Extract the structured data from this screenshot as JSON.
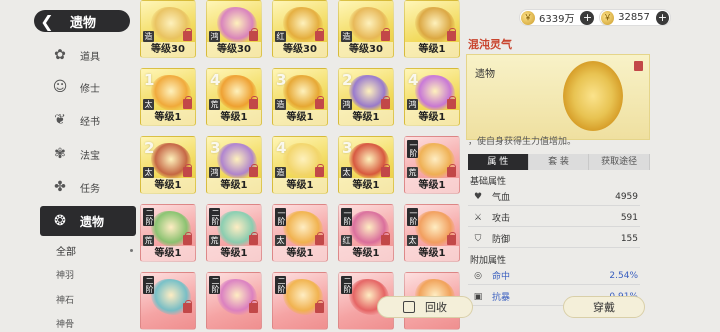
{
  "header": {
    "title": "遗物",
    "back_icon": "chevron-left-icon"
  },
  "resources": [
    {
      "icon": "coin-icon",
      "value": "6339万"
    },
    {
      "icon": "coin-icon",
      "value": "32857"
    }
  ],
  "sidebar": {
    "items": [
      {
        "label": "道具",
        "icon": "daoju-icon"
      },
      {
        "label": "修士",
        "icon": "xiushi-icon"
      },
      {
        "label": "经书",
        "icon": "jingshu-icon"
      },
      {
        "label": "法宝",
        "icon": "fabao-icon"
      },
      {
        "label": "任务",
        "icon": "renwu-icon"
      },
      {
        "label": "遗物",
        "icon": "yiwu-icon",
        "active": true
      }
    ],
    "sub_items": [
      "全部",
      "神羽",
      "神石",
      "神骨"
    ]
  },
  "grid": {
    "cards": [
      {
        "tier": "",
        "tag": "造",
        "level": "等级30",
        "style": "gold",
        "art": "#e8c060"
      },
      {
        "tier": "",
        "tag": "鸿",
        "level": "等级30",
        "style": "gold",
        "art": "#d67ac4"
      },
      {
        "tier": "",
        "tag": "红",
        "level": "等级30",
        "style": "gold",
        "art": "#e3a93a"
      },
      {
        "tier": "",
        "tag": "造",
        "level": "等级30",
        "style": "gold",
        "art": "#e6b455"
      },
      {
        "tier": "",
        "tag": "",
        "level": "等级1",
        "style": "gold",
        "art": "#d9a23f"
      },
      {
        "tier": "1",
        "tag": "太",
        "level": "等级1",
        "style": "gold",
        "art": "#f0a436"
      },
      {
        "tier": "4",
        "tag": "荒",
        "level": "等级1",
        "style": "gold",
        "art": "#ee9a2b"
      },
      {
        "tier": "3",
        "tag": "造",
        "level": "等级1",
        "style": "gold",
        "art": "#e5a22e"
      },
      {
        "tier": "2",
        "tag": "鸿",
        "level": "等级1",
        "style": "gold",
        "art": "#8f6fd6"
      },
      {
        "tier": "4",
        "tag": "鸿",
        "level": "等级1",
        "style": "gold",
        "art": "#c36de0"
      },
      {
        "tier": "2",
        "tag": "太",
        "level": "等级1",
        "style": "gold",
        "art": "#c05a40"
      },
      {
        "tier": "3",
        "tag": "鸿",
        "level": "等级1",
        "style": "gold",
        "art": "#a87ad8"
      },
      {
        "tier": "4",
        "tag": "造",
        "level": "等级1",
        "style": "gold",
        "art": "#f2d46b"
      },
      {
        "tier": "3",
        "tag": "太",
        "level": "等级1",
        "style": "gold",
        "art": "#d44a3a"
      },
      {
        "tier": "一阶",
        "tag": "荒",
        "level": "等级1",
        "style": "red",
        "art": "#eeb04a"
      },
      {
        "tier": "二阶",
        "tag": "荒",
        "level": "等级1",
        "style": "red",
        "art": "#7fc46a"
      },
      {
        "tier": "二阶",
        "tag": "荒",
        "level": "等级1",
        "style": "red",
        "art": "#7fd0b0"
      },
      {
        "tier": "一阶",
        "tag": "太",
        "level": "等级1",
        "style": "red",
        "art": "#f0b345"
      },
      {
        "tier": "一阶",
        "tag": "红",
        "level": "等级1",
        "style": "red",
        "art": "#d7689a"
      },
      {
        "tier": "一阶",
        "tag": "太",
        "level": "等级1",
        "style": "red",
        "art": "#f19d56"
      },
      {
        "tier": "二阶",
        "tag": "",
        "level": "",
        "style": "red",
        "art": "#6ac0c8"
      },
      {
        "tier": "二阶",
        "tag": "",
        "level": "",
        "style": "red",
        "art": "#d87cc2"
      },
      {
        "tier": "二阶",
        "tag": "",
        "level": "",
        "style": "red",
        "art": "#f0b345"
      },
      {
        "tier": "二阶",
        "tag": "",
        "level": "",
        "style": "red",
        "art": "#e35c5c"
      },
      {
        "tier": "",
        "tag": "",
        "level": "",
        "style": "red",
        "art": "#f0a050"
      }
    ]
  },
  "detail": {
    "name": "混沌灵气",
    "category": "遗物",
    "description": "，使自身获得生力值增加。",
    "tabs": [
      "属 性",
      "套 装",
      "获取途径"
    ],
    "base_title": "基础属性",
    "base_stats": [
      {
        "icon": "heart-icon",
        "name": "气血",
        "value": "4959"
      },
      {
        "icon": "sword-icon",
        "name": "攻击",
        "value": "591"
      },
      {
        "icon": "shield-icon",
        "name": "防御",
        "value": "155"
      }
    ],
    "extra_title": "附加属性",
    "extra_stats": [
      {
        "icon": "target-icon",
        "name": "命中",
        "value": "2.54%"
      },
      {
        "icon": "armor-icon",
        "name": "抗暴",
        "value": "0.91%"
      }
    ]
  },
  "buttons": {
    "recycle": "回收",
    "equip": "穿戴"
  }
}
